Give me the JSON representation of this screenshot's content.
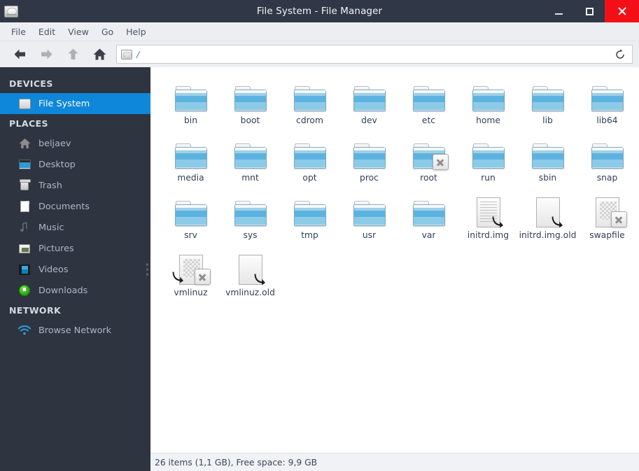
{
  "window": {
    "title": "File System - File Manager",
    "icon": "hard-drive-icon",
    "minimize": "–",
    "maximize": "□",
    "close": "✕",
    "close_color": "#f40f17",
    "titlebar_color": "#303847"
  },
  "menubar": {
    "items": [
      {
        "label": "File"
      },
      {
        "label": "Edit"
      },
      {
        "label": "View"
      },
      {
        "label": "Go"
      },
      {
        "label": "Help"
      }
    ]
  },
  "toolbar": {
    "back": {
      "name": "back-button",
      "enabled": true
    },
    "forward": {
      "name": "forward-button",
      "enabled": false
    },
    "up": {
      "name": "up-button",
      "enabled": false
    },
    "home": {
      "name": "home-button",
      "enabled": true
    },
    "path": "/",
    "path_icon": "hard-drive-icon",
    "reload": "⟳"
  },
  "sidebar": {
    "bg_color": "#2e3440",
    "accent_color": "#0e87d9",
    "sections": [
      {
        "title": "DEVICES",
        "items": [
          {
            "label": "File System",
            "icon": "hard-drive-icon",
            "active": true
          }
        ]
      },
      {
        "title": "PLACES",
        "items": [
          {
            "label": "beljaev",
            "icon": "home-icon",
            "active": false
          },
          {
            "label": "Desktop",
            "icon": "desktop-icon",
            "active": false
          },
          {
            "label": "Trash",
            "icon": "trash-icon",
            "active": false
          },
          {
            "label": "Documents",
            "icon": "document-icon",
            "active": false
          },
          {
            "label": "Music",
            "icon": "music-note-icon",
            "active": false
          },
          {
            "label": "Pictures",
            "icon": "pictures-icon",
            "active": false
          },
          {
            "label": "Videos",
            "icon": "video-icon",
            "active": false
          },
          {
            "label": "Downloads",
            "icon": "download-icon",
            "active": false
          }
        ]
      },
      {
        "title": "NETWORK",
        "items": [
          {
            "label": "Browse Network",
            "icon": "wifi-icon",
            "active": false
          }
        ]
      }
    ]
  },
  "files": [
    {
      "name": "bin",
      "type": "folder",
      "overlay": "none"
    },
    {
      "name": "boot",
      "type": "folder",
      "overlay": "none"
    },
    {
      "name": "cdrom",
      "type": "folder",
      "overlay": "none"
    },
    {
      "name": "dev",
      "type": "folder",
      "overlay": "none"
    },
    {
      "name": "etc",
      "type": "folder",
      "overlay": "none"
    },
    {
      "name": "home",
      "type": "folder",
      "overlay": "none"
    },
    {
      "name": "lib",
      "type": "folder",
      "overlay": "none"
    },
    {
      "name": "lib64",
      "type": "folder",
      "overlay": "none"
    },
    {
      "name": "media",
      "type": "folder",
      "overlay": "none"
    },
    {
      "name": "mnt",
      "type": "folder",
      "overlay": "none"
    },
    {
      "name": "opt",
      "type": "folder",
      "overlay": "none"
    },
    {
      "name": "proc",
      "type": "folder",
      "overlay": "none"
    },
    {
      "name": "root",
      "type": "folder",
      "overlay": "denied"
    },
    {
      "name": "run",
      "type": "folder",
      "overlay": "none"
    },
    {
      "name": "sbin",
      "type": "folder",
      "overlay": "none"
    },
    {
      "name": "snap",
      "type": "folder",
      "overlay": "none"
    },
    {
      "name": "srv",
      "type": "folder",
      "overlay": "none"
    },
    {
      "name": "sys",
      "type": "folder",
      "overlay": "none"
    },
    {
      "name": "tmp",
      "type": "folder",
      "overlay": "none"
    },
    {
      "name": "usr",
      "type": "folder",
      "overlay": "none"
    },
    {
      "name": "var",
      "type": "folder",
      "overlay": "none"
    },
    {
      "name": "initrd.img",
      "type": "text-file",
      "overlay": "symlink"
    },
    {
      "name": "initrd.img.old",
      "type": "blank-file",
      "overlay": "symlink"
    },
    {
      "name": "swapfile",
      "type": "unknown-file",
      "overlay": "denied"
    },
    {
      "name": "vmlinuz",
      "type": "unknown-file",
      "overlay": "denied-symlink"
    },
    {
      "name": "vmlinuz.old",
      "type": "blank-file",
      "overlay": "symlink"
    }
  ],
  "statusbar": {
    "text": "26 items (1,1 GB), Free space: 9,9 GB"
  }
}
